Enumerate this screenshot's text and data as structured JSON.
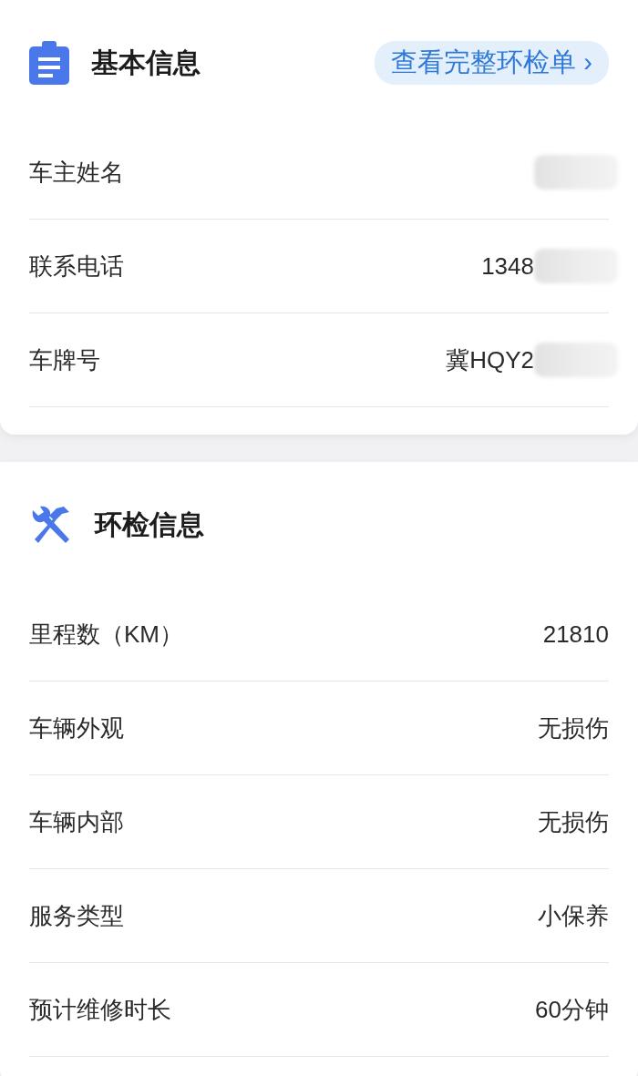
{
  "sections": [
    {
      "title": "基本信息",
      "link": {
        "label": "查看完整环检单",
        "arrow": "›"
      },
      "rows": [
        {
          "label": "车主姓名",
          "redacted": true
        },
        {
          "label": "联系电话",
          "value": "1348",
          "redacted": true
        },
        {
          "label": "车牌号",
          "value": "冀HQY2",
          "redacted": true
        }
      ]
    },
    {
      "title": "环检信息",
      "rows": [
        {
          "label": "里程数（KM）",
          "value": "21810"
        },
        {
          "label": "车辆外观",
          "value": "无损伤"
        },
        {
          "label": "车辆内部",
          "value": "无损伤"
        },
        {
          "label": "服务类型",
          "value": "小保养"
        },
        {
          "label": "预计维修时长",
          "value": "60分钟"
        }
      ]
    }
  ]
}
